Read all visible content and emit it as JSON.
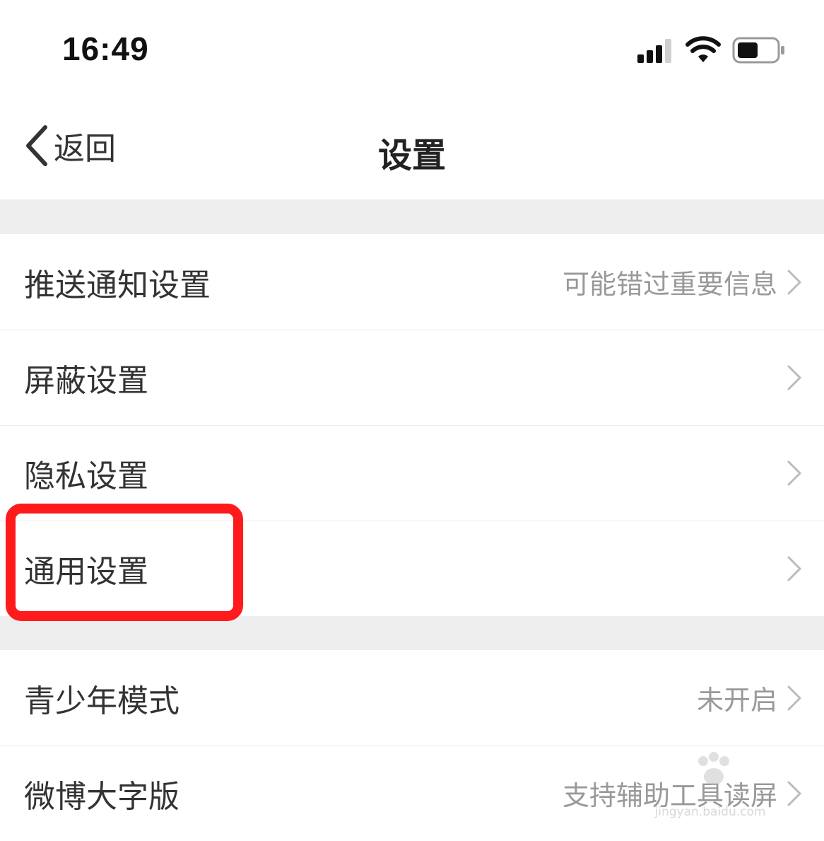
{
  "status_bar": {
    "time": "16:49",
    "icons": [
      "signal-icon",
      "wifi-icon",
      "battery-icon"
    ]
  },
  "nav": {
    "back_label": "返回",
    "title": "设置",
    "back_icon": "chevron-left-icon"
  },
  "groups": [
    {
      "items": [
        {
          "label": "推送通知设置",
          "value": "可能错过重要信息"
        },
        {
          "label": "屏蔽设置",
          "value": ""
        },
        {
          "label": "隐私设置",
          "value": ""
        },
        {
          "label": "通用设置",
          "value": "",
          "highlighted": true
        }
      ]
    },
    {
      "items": [
        {
          "label": "青少年模式",
          "value": "未开启"
        },
        {
          "label": "微博大字版",
          "value": "支持辅助工具读屏"
        }
      ]
    }
  ],
  "watermark": {
    "text": "jingyan.baidu.com"
  },
  "colors": {
    "background": "#ffffff",
    "section_gap": "#eeeeee",
    "label_text": "#333333",
    "value_text": "#999999",
    "chevron": "#bbbbbb",
    "highlight": "#ff1b1b"
  }
}
